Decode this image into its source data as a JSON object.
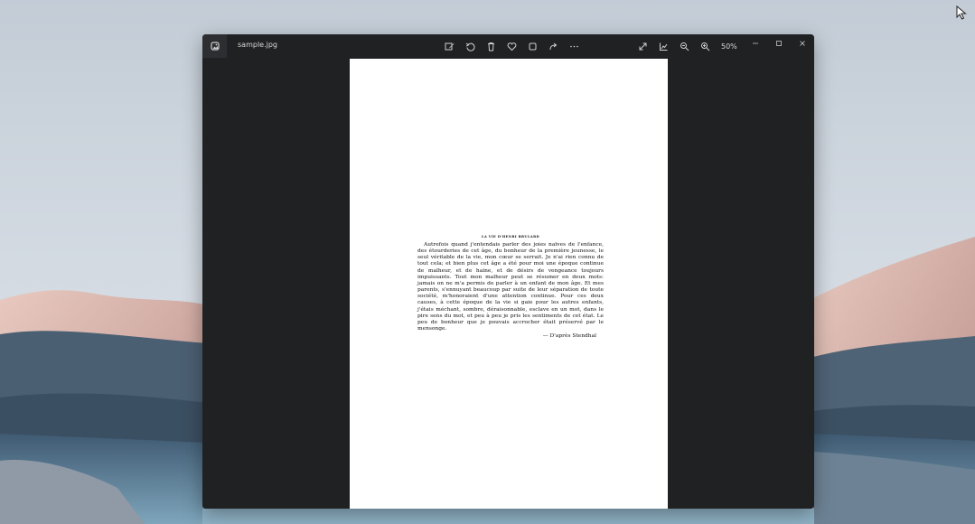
{
  "window": {
    "file_name": "sample.jpg",
    "zoom_level": "50%"
  },
  "toolbar": {
    "center_buttons": [
      {
        "name": "edit-image-button",
        "icon": "edit-image-icon"
      },
      {
        "name": "rotate-button",
        "icon": "rotate-icon"
      },
      {
        "name": "delete-button",
        "icon": "trash-icon"
      },
      {
        "name": "favorite-button",
        "icon": "heart-icon"
      },
      {
        "name": "crop-button",
        "icon": "crop-icon"
      },
      {
        "name": "share-button",
        "icon": "share-icon"
      },
      {
        "name": "more-button",
        "icon": "more-icon"
      }
    ],
    "right_buttons": [
      {
        "name": "fullscreen-button",
        "icon": "expand-icon"
      },
      {
        "name": "info-button",
        "icon": "chart-icon"
      },
      {
        "name": "zoom-out-button",
        "icon": "zoom-out-icon"
      },
      {
        "name": "zoom-in-button",
        "icon": "zoom-in-icon"
      }
    ]
  },
  "document": {
    "title": "LA VIE D'HENRI BRULARD",
    "body": "Autrefois quand j'entendais parler des joies naïves de l'enfance, des étourderies de cet âge, du bonheur de la première jeunesse, le seul véritable de la vie, mon cœur se serrait. Je n'ai rien connu de tout cela; et bien plus cet âge a été pour moi une époque continue de malheur, et de haine, et de désirs de vengeance toujours impuissants. Tout mon malheur peut se résumer en deux mots: jamais on ne m'a permis de parler à un enfant de mon âge. Et mes parents, s'ennuyant beaucoup par suite de leur séparation de toute société, m'honoraient d'une attention continue. Pour ces deux causes, à cette époque de la vie si gaie pour les autres enfants, j'étais méchant, sombre, déraisonnable, esclave en un mot, dans le pire sens du mot, et peu à peu je pris les sentiments de cet état. Le peu de bonheur que je pouvais accrocher était préservé par le mensonge.",
    "signature": "— D'après Stendhal"
  },
  "colors": {
    "window_bg": "#202123",
    "titlebar_icon": "#d0d0d0",
    "page_bg": "#ffffff"
  }
}
